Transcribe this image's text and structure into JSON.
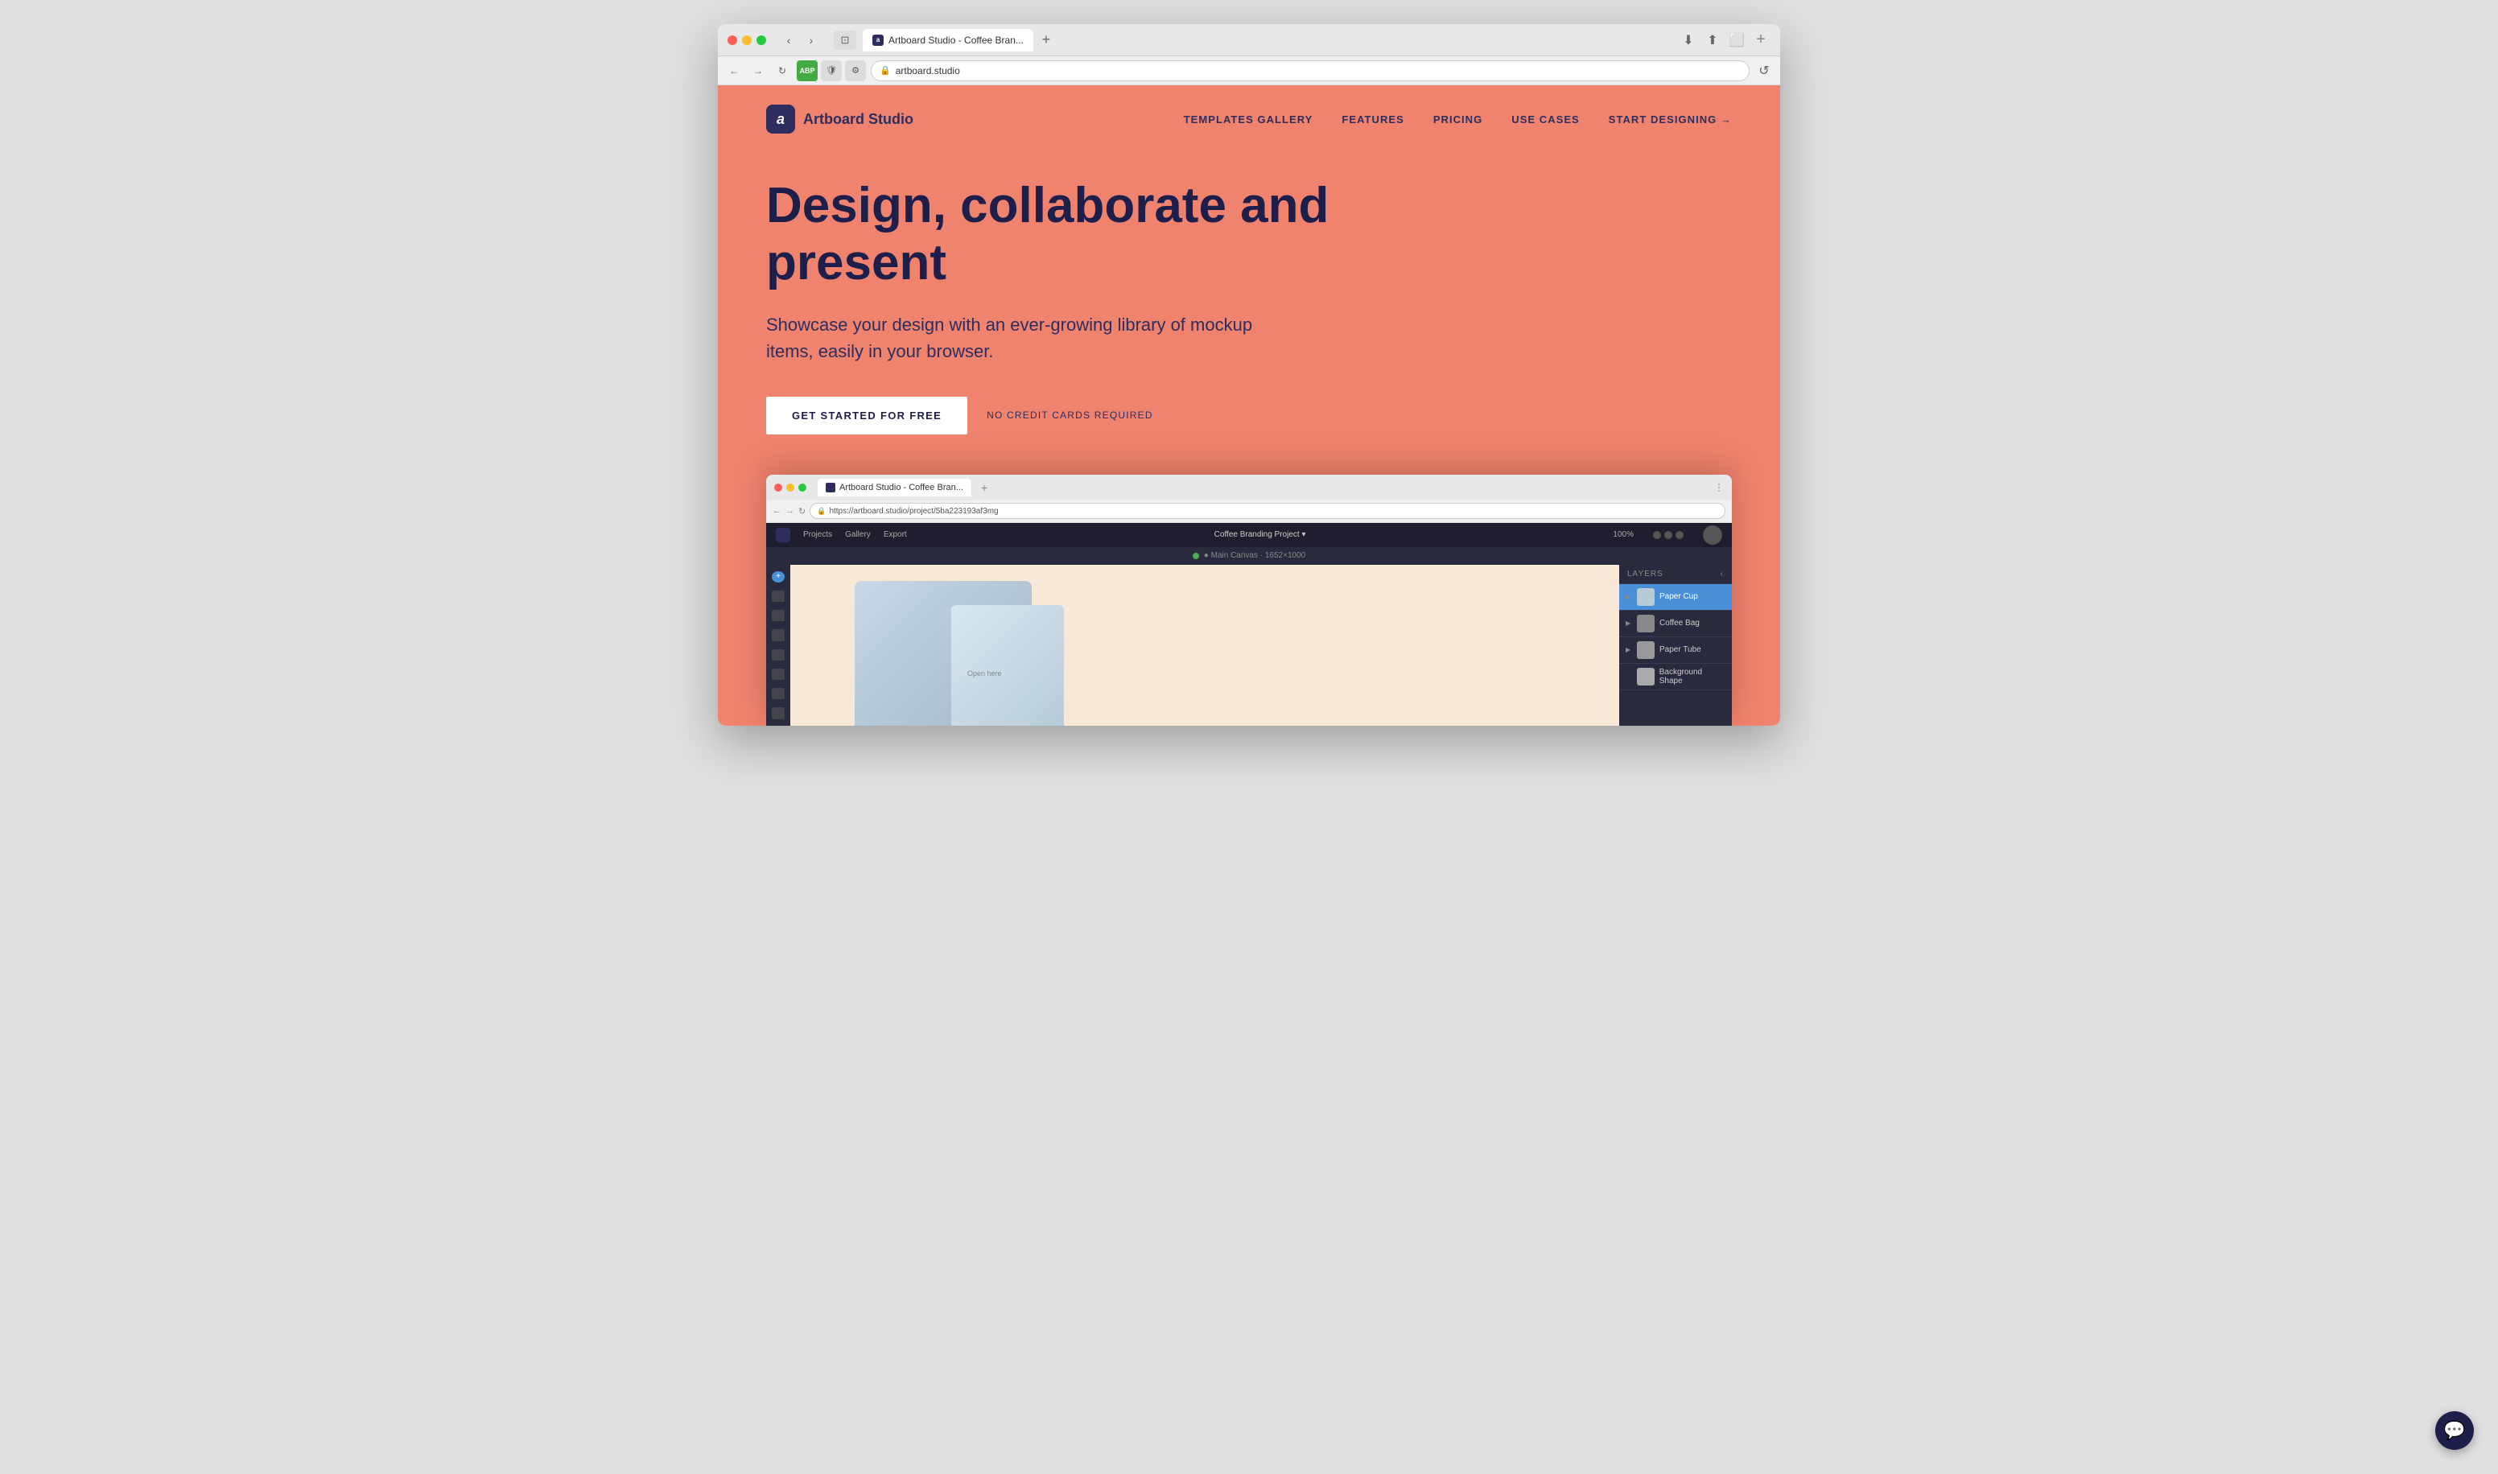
{
  "browser": {
    "url": "artboard.studio",
    "full_url": "https://artboard.studio",
    "tab_title": "Artboard Studio - Coffee Bran...",
    "back_btn": "‹",
    "forward_btn": "›",
    "reload_icon": "↺",
    "new_tab_icon": "+"
  },
  "nav": {
    "logo_letter": "a",
    "logo_text": "Artboard Studio",
    "links": [
      {
        "label": "TEMPLATES GALLERY"
      },
      {
        "label": "FEATURES"
      },
      {
        "label": "PRICING"
      },
      {
        "label": "USE CASES"
      },
      {
        "label": "START DESIGNING →"
      }
    ]
  },
  "hero": {
    "title": "Design, collaborate and present",
    "subtitle": "Showcase your design with an ever-growing library of mockup items, easily in your browser.",
    "cta_label": "GET STARTED FOR FREE",
    "no_cc_label": "NO CREDIT CARDS REQUIRED"
  },
  "mockup": {
    "tab_title": "Artboard Studio - Coffee Bran...",
    "toolbar_url": "https://artboard.studio/project/5ba223193af3mg",
    "app_menu": [
      "Projects",
      "Gallery",
      "Export"
    ],
    "project_name": "Coffee Branding Project ▾",
    "canvas_label": "● Main Canvas · 1652×1000",
    "zoom_label": "100%",
    "layers_header": "LAYERS",
    "layers": [
      {
        "name": "Paper Cup",
        "active": true
      },
      {
        "name": "Coffee Bag",
        "active": false
      },
      {
        "name": "Paper Tube",
        "active": false
      },
      {
        "name": "Background Shape",
        "active": false
      }
    ]
  },
  "chat": {
    "icon": "💬"
  }
}
